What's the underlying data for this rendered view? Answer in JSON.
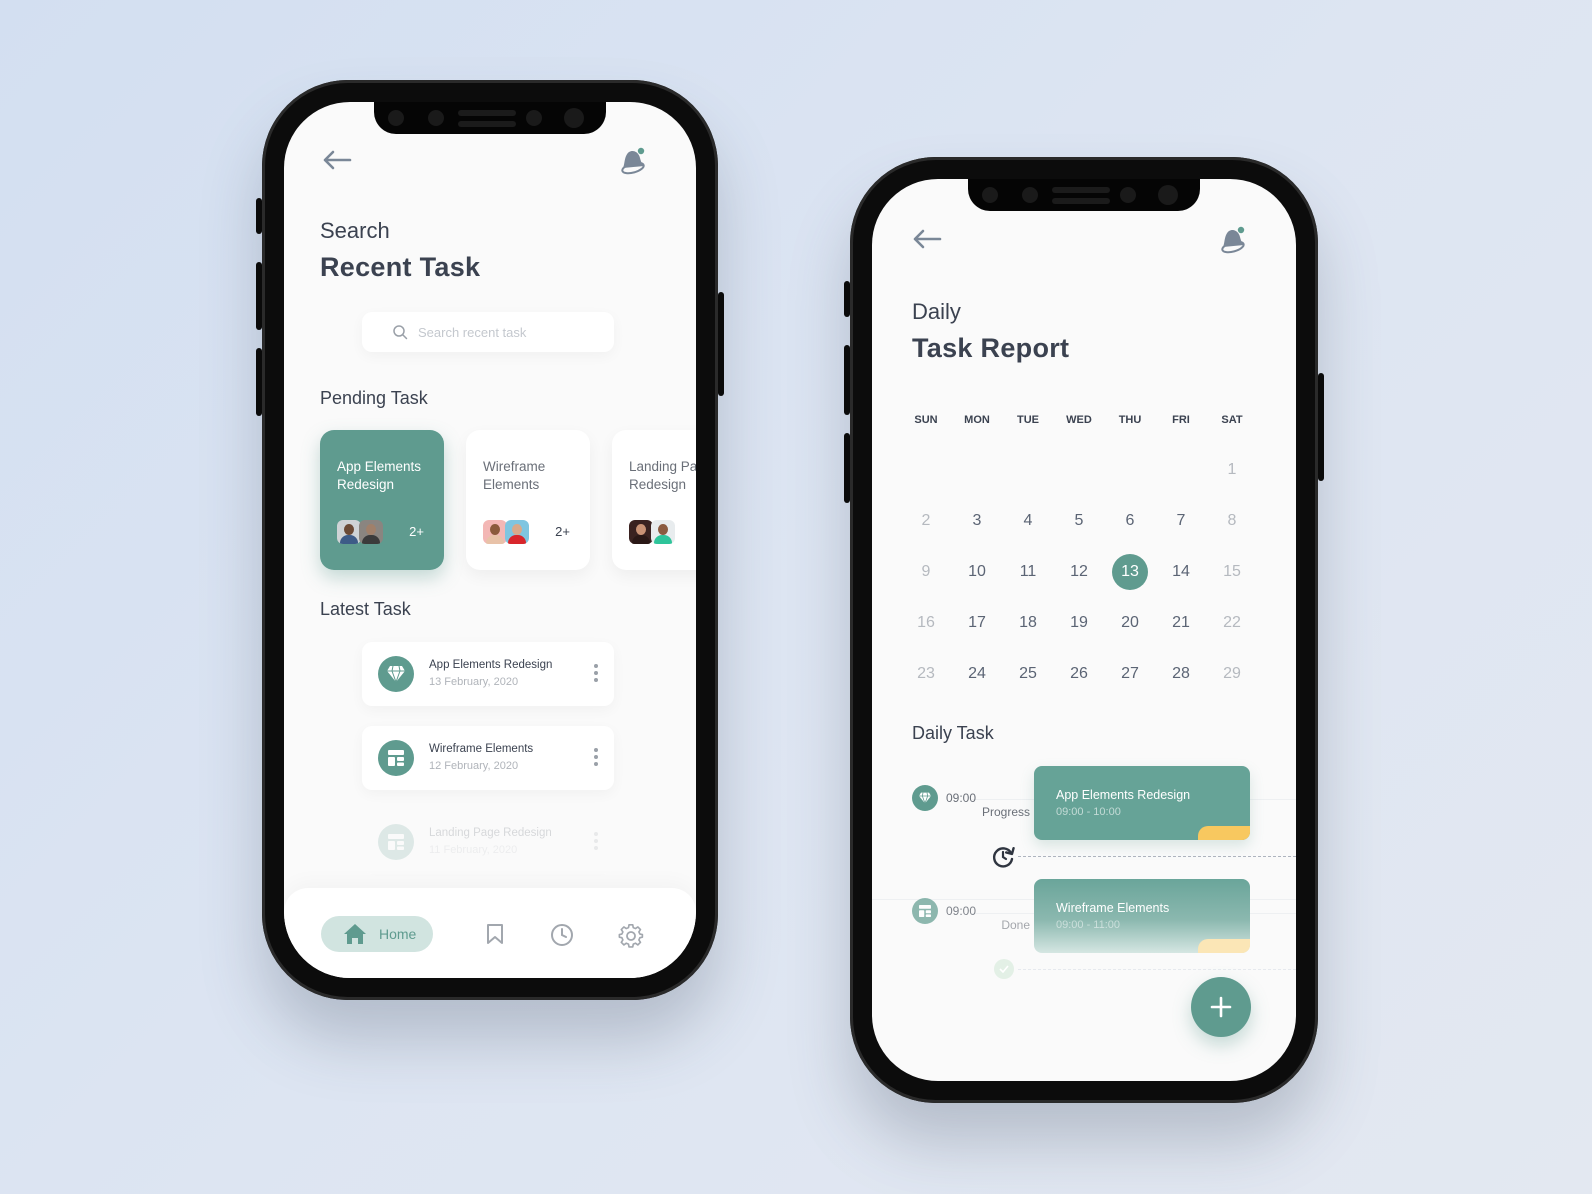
{
  "colors": {
    "accent": "#5f9b8f",
    "accent_light": "#d1e4e0",
    "highlight": "#f8c85f",
    "text_dark": "#3b4250",
    "text_muted": "#b5b9bf",
    "background": "#d3dff1"
  },
  "screen1": {
    "header": {
      "back_icon": "arrow-left-icon",
      "notification_icon": "bell-icon",
      "subtitle": "Search",
      "title": "Recent Task"
    },
    "search": {
      "placeholder": "Search recent task",
      "value": "",
      "icon": "search-icon"
    },
    "pending": {
      "label": "Pending Task",
      "cards": [
        {
          "title_line1": "App Elements",
          "title_line2": "Redesign",
          "more": "2+",
          "active": true
        },
        {
          "title_line1": "Wireframe",
          "title_line2": "Elements",
          "more": "2+",
          "active": false
        },
        {
          "title_line1": "Landing Page",
          "title_line2": "Redesign",
          "more": "",
          "active": false
        }
      ]
    },
    "latest": {
      "label": "Latest Task",
      "items": [
        {
          "title": "App Elements Redesign",
          "date": "13 February, 2020",
          "icon": "diamond-icon"
        },
        {
          "title": "Wireframe Elements",
          "date": "12 February, 2020",
          "icon": "layout-icon"
        },
        {
          "title": "Landing Page Redesign",
          "date": "11 February, 2020",
          "icon": "layout-icon"
        }
      ]
    },
    "nav": {
      "home_label": "Home",
      "items": [
        "home-icon",
        "bookmark-icon",
        "clock-icon",
        "gear-icon"
      ]
    }
  },
  "screen2": {
    "header": {
      "back_icon": "arrow-left-icon",
      "notification_icon": "bell-icon",
      "subtitle": "Daily",
      "title": "Task Report"
    },
    "calendar": {
      "weekdays": [
        "SUN",
        "MON",
        "TUE",
        "WED",
        "THU",
        "FRI",
        "SAT"
      ],
      "weeks": [
        [
          "",
          "",
          "",
          "",
          "",
          "",
          "1"
        ],
        [
          "2",
          "3",
          "4",
          "5",
          "6",
          "7",
          "8"
        ],
        [
          "9",
          "10",
          "11",
          "12",
          "13",
          "14",
          "15"
        ],
        [
          "16",
          "17",
          "18",
          "19",
          "20",
          "21",
          "22"
        ],
        [
          "23",
          "24",
          "25",
          "26",
          "27",
          "28",
          "29"
        ]
      ],
      "selected": "13"
    },
    "daily": {
      "label": "Daily Task",
      "tasks": [
        {
          "time": "09:00",
          "status": "Progress",
          "title": "App Elements Redesign",
          "range": "09:00 - 10:00",
          "icon": "diamond-icon"
        },
        {
          "time": "09:00",
          "status": "Done",
          "title": "Wireframe Elements",
          "range": "09:00 - 11:00",
          "icon": "layout-icon"
        }
      ],
      "add_button": "plus-icon"
    }
  }
}
